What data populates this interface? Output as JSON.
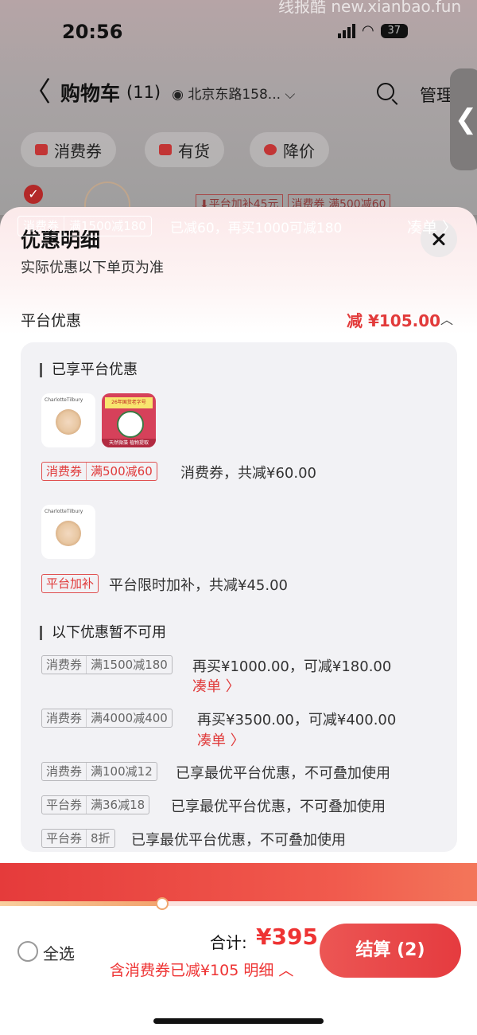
{
  "status_bar": {
    "time": "20:56",
    "battery": "37"
  },
  "watermark": "线报酷 new.xianbao.fun",
  "background_page": {
    "back_symbol": "〈",
    "title": "购物车",
    "count": "(11)",
    "address": "◉ 北京东路158... ⌵",
    "manage": "管理",
    "side_handle": "❮",
    "filter_chips": [
      "消费券",
      "有货",
      "降价"
    ],
    "item_check": "✓",
    "item_tags": [
      "⬇平台加补45元",
      "消费券 满500减60"
    ]
  },
  "sheet": {
    "title": "优惠明细",
    "subtitle": "实际优惠以下单页为准",
    "platform_section": {
      "label": "平台优惠",
      "total": "减 ¥105.00",
      "chevron": "︿"
    },
    "enjoyed": {
      "title": "已享平台优惠",
      "groups": [
        {
          "badge_type": "消费券",
          "badge_rule": "满500减60",
          "text": "消费券，共减¥60.00",
          "products": [
            {
              "brand": "CharlotteTilbury",
              "kind": "compact"
            },
            {
              "top_text": "26年国货老字号",
              "band_text": "天然微藻 植物提取",
              "kind": "mask"
            }
          ]
        },
        {
          "badge_type": "平台加补",
          "text": "平台限时加补，共减¥45.00",
          "products": [
            {
              "brand": "CharlotteTilbury",
              "kind": "compact"
            }
          ]
        }
      ]
    },
    "unavailable": {
      "title": "以下优惠暂不可用",
      "rows": [
        {
          "type": "消费券",
          "rule": "满1500减180",
          "text": "再买¥1000.00，可减¥180.00",
          "action": "凑单 〉"
        },
        {
          "type": "消费券",
          "rule": "满4000减400",
          "text": "再买¥3500.00，可减¥400.00",
          "action": "凑单 〉"
        },
        {
          "type": "消费券",
          "rule": "满100减12",
          "text": "已享最优平台优惠，不可叠加使用"
        },
        {
          "type": "平台券",
          "rule": "满36减18",
          "text": "已享最优平台优惠，不可叠加使用"
        },
        {
          "type": "平台券",
          "rule": "8折",
          "text": "已享最优平台优惠，不可叠加使用"
        }
      ]
    }
  },
  "promo_bar": {
    "badge_type": "消费券",
    "badge_rule": "满1500减180",
    "text": "已减60，再买1000可减180",
    "action": "凑单 〉",
    "progress": 0.34
  },
  "bottom_bar": {
    "select_all": "全选",
    "total_label": "合计:",
    "total_amount": "¥395",
    "discount_note": "含消费券已减¥105 明细 ︿",
    "checkout": "结算 (2)"
  },
  "colors": {
    "accent": "#e53b3b",
    "panel": "#f2f2f5"
  }
}
